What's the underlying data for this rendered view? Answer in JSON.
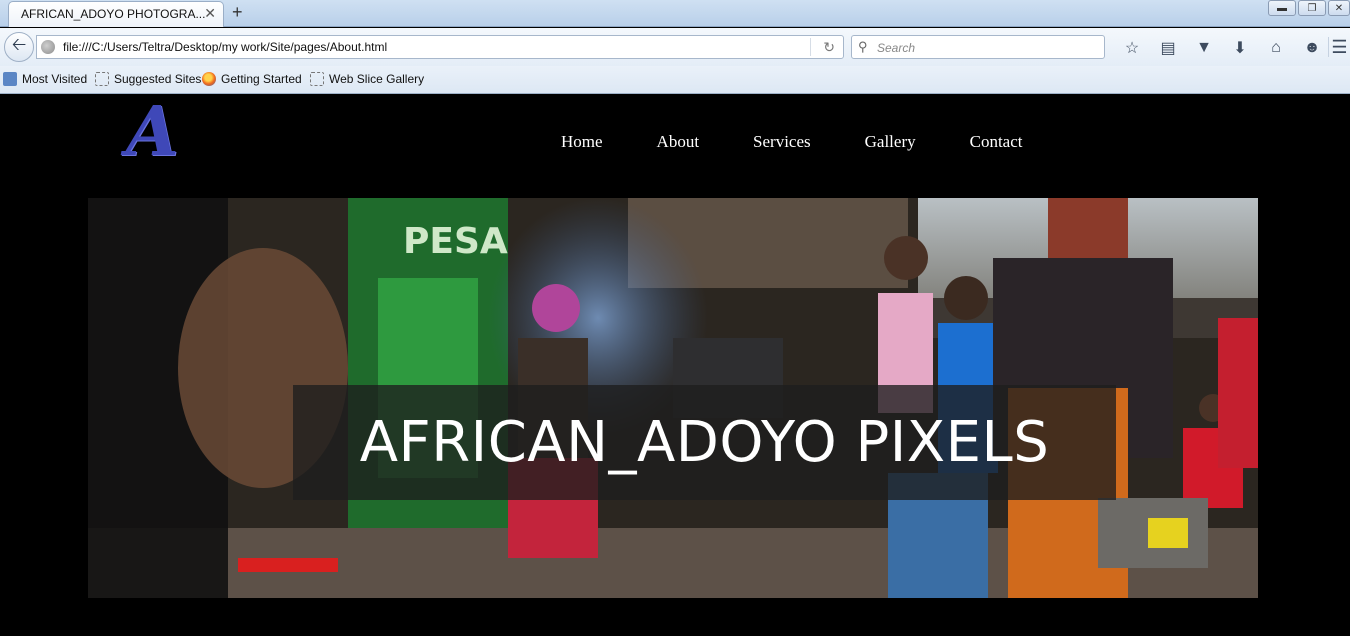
{
  "browser": {
    "tab_title": "AFRICAN_ADOYO PHOTOGRA...",
    "tab_close": "✕",
    "new_tab": "+",
    "url": "file:///C:/Users/Teltra/Desktop/my work/Site/pages/About.html",
    "search_placeholder": "Search",
    "bookmarks": [
      "Most Visited",
      "Suggested Sites",
      "Getting Started",
      "Web Slice Gallery"
    ]
  },
  "site": {
    "logo_letter": "A",
    "nav": [
      "Home",
      "About",
      "Services",
      "Gallery",
      "Contact"
    ],
    "hero_title": "AFRICAN_ADOYO PIXELS"
  },
  "colors": {
    "page_background": "#000000",
    "logo": "#3f48b8",
    "nav_text": "#ffffff"
  }
}
